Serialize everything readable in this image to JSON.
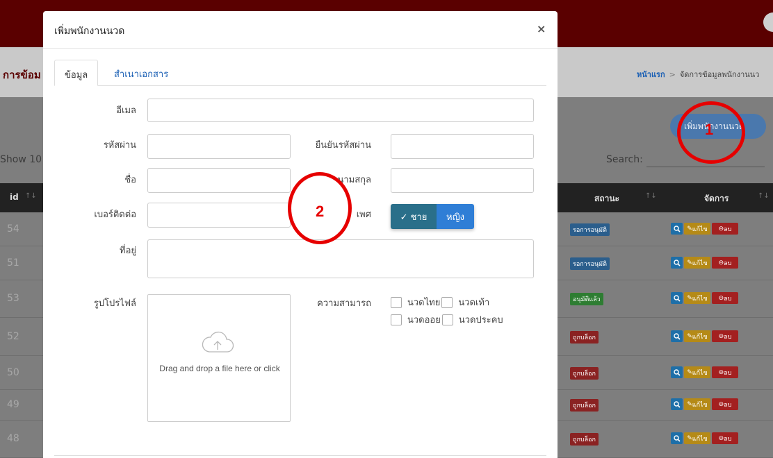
{
  "background": {
    "page_title": "การข้อม",
    "breadcrumb": {
      "home": "หน้าแรก",
      "separator": ">",
      "current": "จัดการข้อมูลพนักงานนว"
    },
    "add_button_label": "เพิ่มพนักงานนวด",
    "show_label": "Show  10",
    "search_label": "Search:",
    "table": {
      "columns": {
        "id": "id",
        "status": "สถานะ",
        "manage": "จัดการ",
        "sort_icon": "↑↓"
      },
      "rows": [
        {
          "id": "54",
          "status": "รอการอนุมัติ",
          "status_type": "wait"
        },
        {
          "id": "51",
          "status": "รอการอนุมัติ",
          "status_type": "wait"
        },
        {
          "id": "53",
          "status": "อนุมัติแล้ว",
          "status_type": "ok"
        },
        {
          "id": "52",
          "status": "ถูกบล็อก",
          "status_type": "lock"
        },
        {
          "id": "50",
          "status": "ถูกบล็อก",
          "status_type": "lock"
        },
        {
          "id": "49",
          "status": "ถูกบล็อก",
          "status_type": "lock"
        },
        {
          "id": "48",
          "status": "ถูกบล็อก",
          "status_type": "lock"
        }
      ],
      "actions": {
        "view_icon": "magnifier-icon",
        "edit": "แก้ไข",
        "delete": "ลบ"
      }
    }
  },
  "modal": {
    "title": "เพิ่มพนักงานนวด",
    "close": "×",
    "tabs": [
      "ข้อมูล",
      "สำเนาเอกสาร"
    ],
    "fields": {
      "email": "อีเมล",
      "password": "รหัสผ่าน",
      "confirm_password": "ยืนยันรหัสผ่าน",
      "first_name": "ชื่อ",
      "last_name": "นามสกุล",
      "phone": "เบอร์ติดต่อ",
      "gender": "เพศ",
      "address": "ที่อยู่",
      "profile_picture": "รูปโปรไฟล์",
      "skills": "ความสามารถ"
    },
    "gender_options": {
      "male": "✓ ชาย",
      "female": "หญิง",
      "selected": "male"
    },
    "dropzone_text": "Drag and drop a file here or click",
    "skill_options": [
      "นวดไทย",
      "นวดเท้า",
      "นวดออย",
      "นวดประคบ"
    ]
  },
  "annotations": [
    "1",
    "2"
  ],
  "colors": {
    "accent": "#e60000",
    "topbar": "#5a0000",
    "primary": "#2f7ed6"
  }
}
